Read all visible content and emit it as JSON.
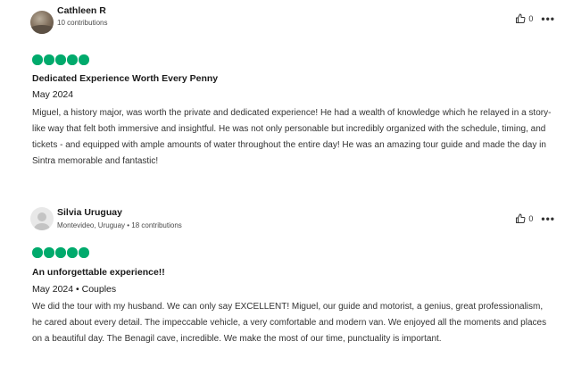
{
  "reviews": [
    {
      "user_name": "Cathleen R",
      "user_meta": "10 contributions",
      "likes": "0",
      "more_label": "•••",
      "rating": 5,
      "title": "Dedicated Experience Worth Every Penny",
      "date": "May 2024",
      "text": "Miguel, a history major, was worth the private and dedicated experience! He had a wealth of knowledge which he relayed in a story-like way that felt both immersive and insightful. He was not only personable but incredibly organized with the schedule, timing, and tickets - and equipped with ample amounts of water throughout the entire day! He was an amazing tour guide and made the day in Sintra memorable and fantastic!",
      "avatar": "user-photo"
    },
    {
      "user_name": "Silvia Uruguay",
      "user_meta": "Montevideo, Uruguay • 18 contributions",
      "likes": "0",
      "more_label": "•••",
      "rating": 5,
      "title": "An unforgettable experience!!",
      "date": "May 2024 • Couples",
      "text": "We did the tour with my husband. We can only say EXCELLENT! Miguel, our guide and motorist, a genius, great professionalism, he cared about every detail. The impeccable vehicle, a very comfortable and modern van. We enjoyed all the moments and places on a beautiful day. The Benagil cave, incredible. We make the most of our time, punctuality is important.",
      "avatar": "default-user"
    }
  ],
  "colors": {
    "rating_bubble": "#00aa6c",
    "text": "#1a1a1a",
    "body_text": "#333333"
  },
  "icons": {
    "like": "thumbs-up-icon",
    "more": "more-options-icon"
  }
}
